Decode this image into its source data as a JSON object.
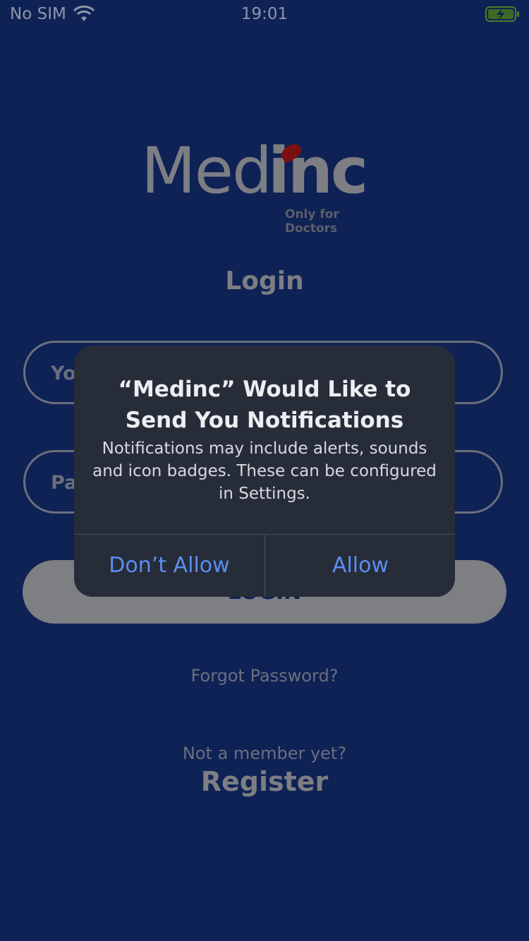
{
  "status_bar": {
    "carrier": "No SIM",
    "time": "19:01",
    "wifi_icon": "wifi-icon",
    "battery_icon": "battery-charging-icon"
  },
  "logo": {
    "text_part1": "Med",
    "text_part2": "inc",
    "tagline": "Only for Doctors"
  },
  "login": {
    "title": "Login",
    "email_placeholder_visible": "Yo",
    "password_placeholder_visible": "Pa",
    "button_label": "LOGIN",
    "forgot_password": "Forgot Password?",
    "not_member": "Not a member yet?",
    "register": "Register"
  },
  "dialog": {
    "title": "“Medinc” Would Like to Send You Notifications",
    "message": "Notifications may include alerts, sounds and icon badges. These can be configured in Settings.",
    "deny_label": "Don’t Allow",
    "allow_label": "Allow"
  },
  "colors": {
    "background": "#0f2256",
    "dialog_bg": "#272c39",
    "accent_blue": "#5b8ef0",
    "logo_red": "#7a1010"
  }
}
